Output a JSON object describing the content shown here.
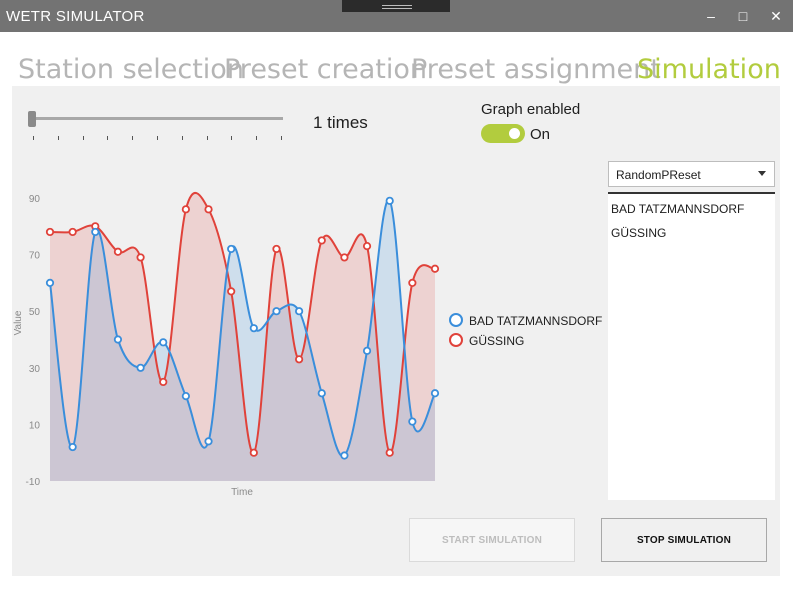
{
  "window": {
    "title": "WETR SIMULATOR",
    "controls": {
      "minimize": "–",
      "maximize": "□",
      "close": "✕"
    }
  },
  "tabs": [
    {
      "label": "Station selection",
      "active": false
    },
    {
      "label": "Preset creation",
      "active": false
    },
    {
      "label": "Preset assignment",
      "active": false
    },
    {
      "label": "Simulation",
      "active": true
    }
  ],
  "simulation": {
    "speed_text": "1 times",
    "speed_value": 1,
    "graph_enabled_label": "Graph enabled",
    "graph_toggle_text": "On",
    "graph_enabled": true
  },
  "preset": {
    "selected": "RandomPReset",
    "stations": [
      "BAD TATZMANNSDORF",
      "GÜSSING"
    ]
  },
  "buttons": {
    "start": "START SIMULATION",
    "stop": "STOP SIMULATION"
  },
  "colors": {
    "accent": "#b2cc3e",
    "series_blue": "#3a8edb",
    "series_red": "#e0423a"
  },
  "chart_data": {
    "type": "area",
    "xlabel": "Time",
    "ylabel": "Value",
    "ylim": [
      -10,
      90
    ],
    "yticks": [
      -10,
      10,
      30,
      50,
      70,
      90
    ],
    "legend_position": "right",
    "grid": false,
    "series": [
      {
        "name": "BAD TATZMANNSDORF",
        "color": "#3a8edb",
        "values": [
          60,
          2,
          78,
          40,
          30,
          39,
          20,
          4,
          72,
          44,
          50,
          50,
          21,
          -1,
          36,
          89,
          11,
          21
        ]
      },
      {
        "name": "GÜSSING",
        "color": "#e0423a",
        "values": [
          78,
          78,
          80,
          71,
          69,
          25,
          86,
          86,
          57,
          0,
          72,
          33,
          75,
          69,
          73,
          0,
          60,
          65
        ]
      }
    ]
  }
}
